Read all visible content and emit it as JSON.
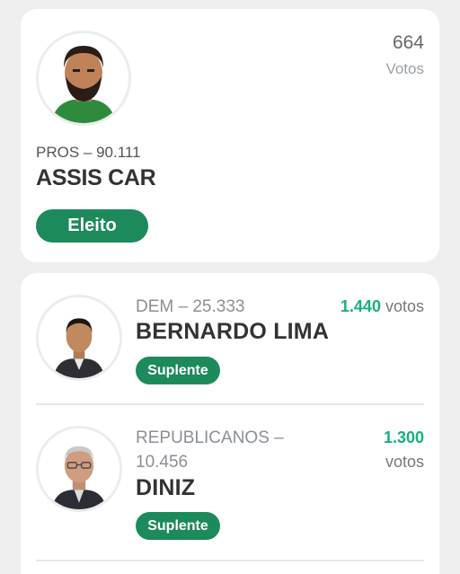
{
  "elected": {
    "party_number": "PROS – 90.111",
    "name": "ASSIS CAR",
    "votes": "664",
    "votes_label": "Votos",
    "status": "Eleito"
  },
  "candidates": [
    {
      "party_number": "DEM – 25.333",
      "name": "BERNARDO LIMA",
      "votes": "1.440",
      "votes_label": "votos",
      "status": "Suplente"
    },
    {
      "party_line1": "REPUBLICANOS –",
      "party_line2": "10.456",
      "name": "DINIZ",
      "votes": "1.300",
      "votes_label": "votos",
      "status": "Suplente"
    }
  ],
  "colors": {
    "badge": "#1d8a5b",
    "votes_accent": "#17b07a",
    "background": "#efefef"
  }
}
